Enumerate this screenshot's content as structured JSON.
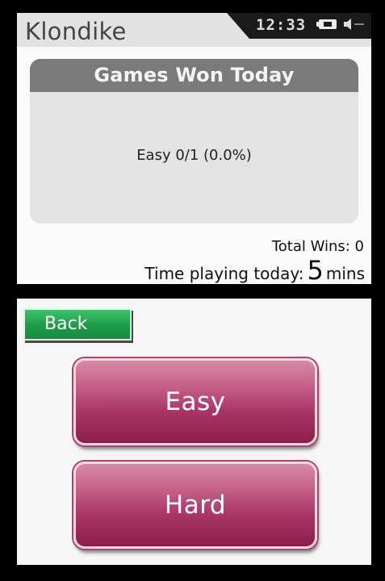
{
  "top": {
    "app_title": "Klondike",
    "clock": "12:33",
    "stats_header": "Games Won Today",
    "stats_line": "Easy  0/1 (0.0%)",
    "total_wins": "Total Wins: 0",
    "time_label": "Time playing today:",
    "time_value": "5",
    "time_unit": "mins"
  },
  "bottom": {
    "back_label": "Back",
    "easy_label": "Easy",
    "hard_label": "Hard"
  },
  "icons": {
    "battery": "battery-icon",
    "volume": "volume-icon"
  },
  "colors": {
    "back_button": "#1f9a4a",
    "mode_button": "#a83565",
    "stats_header": "#7a7a7a"
  }
}
